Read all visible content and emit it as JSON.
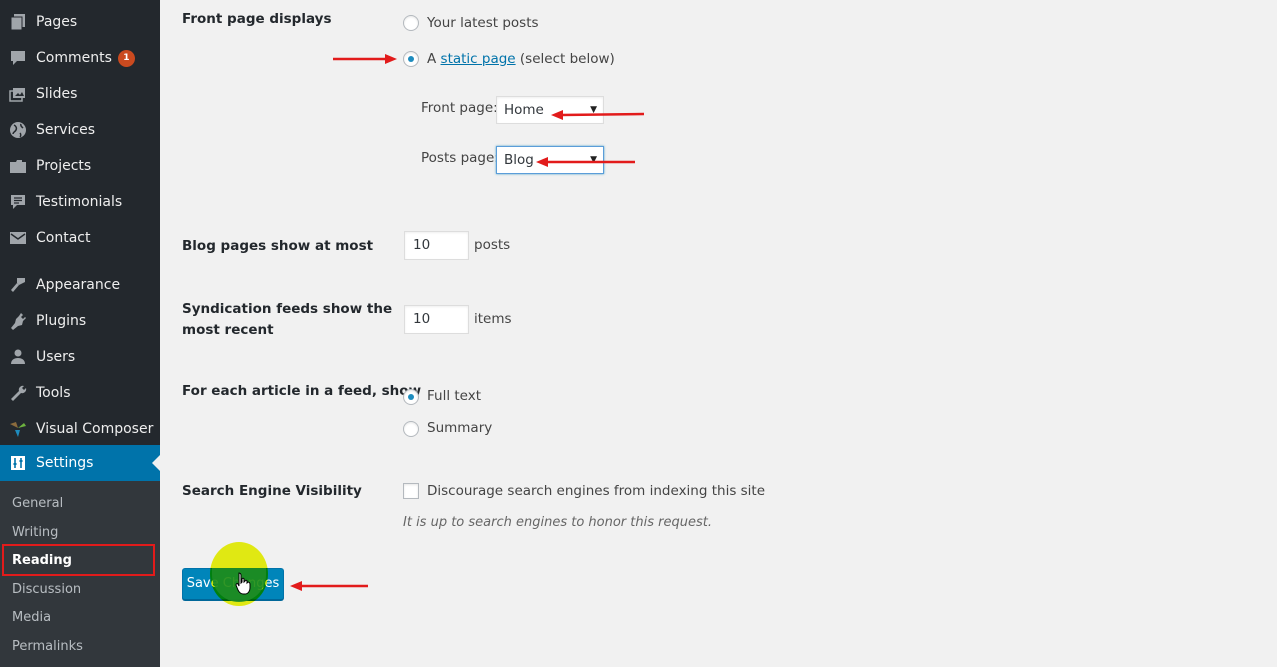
{
  "sidebar": {
    "items": [
      {
        "label": "Pages",
        "icon": "pages-icon"
      },
      {
        "label": "Comments",
        "icon": "comments-icon",
        "badge": "1"
      },
      {
        "label": "Slides",
        "icon": "slides-icon"
      },
      {
        "label": "Services",
        "icon": "globe-icon"
      },
      {
        "label": "Projects",
        "icon": "folder-icon"
      },
      {
        "label": "Testimonials",
        "icon": "testimonial-icon"
      },
      {
        "label": "Contact",
        "icon": "envelope-icon"
      },
      {
        "label": "Appearance",
        "icon": "paintbrush-icon"
      },
      {
        "label": "Plugins",
        "icon": "plug-icon"
      },
      {
        "label": "Users",
        "icon": "user-icon"
      },
      {
        "label": "Tools",
        "icon": "wrench-icon"
      },
      {
        "label": "Visual Composer",
        "icon": "visual-composer-icon"
      },
      {
        "label": "Settings",
        "icon": "settings-sliders-icon",
        "active": true
      }
    ],
    "submenu": [
      {
        "label": "General"
      },
      {
        "label": "Writing"
      },
      {
        "label": "Reading",
        "current": true
      },
      {
        "label": "Discussion"
      },
      {
        "label": "Media"
      },
      {
        "label": "Permalinks"
      }
    ]
  },
  "form": {
    "front_page_displays": {
      "label": "Front page displays",
      "options": [
        {
          "label": "Your latest posts",
          "checked": false
        },
        {
          "prefix": "A ",
          "link": "static page",
          "suffix": " (select below)",
          "checked": true
        }
      ],
      "front_page": {
        "label": "Front page:",
        "value": "Home"
      },
      "posts_page": {
        "label": "Posts page:",
        "value": "Blog"
      }
    },
    "blog_pages": {
      "label": "Blog pages show at most",
      "value": "10",
      "suffix": "posts"
    },
    "syndication": {
      "label_line1": "Syndication feeds show the",
      "label_line2": "most recent",
      "value": "10",
      "suffix": "items"
    },
    "feed_article": {
      "label": "For each article in a feed, show",
      "options": [
        {
          "label": "Full text",
          "checked": true
        },
        {
          "label": "Summary",
          "checked": false
        }
      ]
    },
    "search_visibility": {
      "label": "Search Engine Visibility",
      "checkbox_label": "Discourage search engines from indexing this site",
      "checked": false,
      "description": "It is up to search engines to honor this request."
    },
    "save_label": "Save Changes"
  },
  "annotations": {
    "arrow_color": "#e21b1b",
    "highlight_color": "#e21b1b"
  }
}
